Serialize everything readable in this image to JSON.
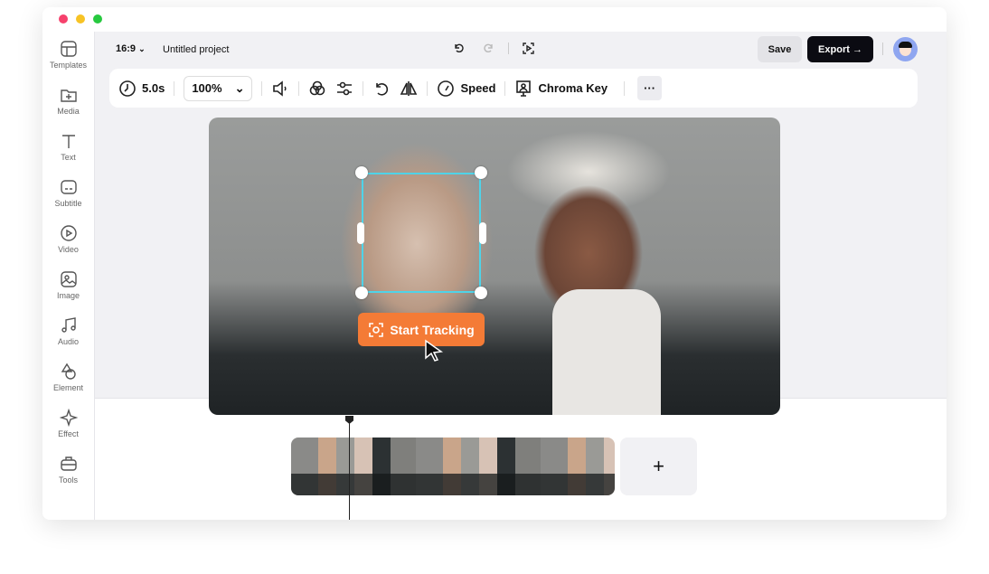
{
  "window": {
    "controls": [
      "close",
      "minimize",
      "maximize"
    ]
  },
  "sidebar": {
    "items": [
      {
        "label": "Templates",
        "icon": "templates-icon"
      },
      {
        "label": "Media",
        "icon": "folder-plus-icon"
      },
      {
        "label": "Text",
        "icon": "text-icon"
      },
      {
        "label": "Subtitle",
        "icon": "subtitle-icon"
      },
      {
        "label": "Video",
        "icon": "video-icon"
      },
      {
        "label": "Image",
        "icon": "image-icon"
      },
      {
        "label": "Audio",
        "icon": "music-icon"
      },
      {
        "label": "Element",
        "icon": "shapes-icon"
      },
      {
        "label": "Effect",
        "icon": "sparkle-icon"
      },
      {
        "label": "Tools",
        "icon": "toolbox-icon"
      }
    ]
  },
  "header": {
    "aspect_ratio": "16:9",
    "project_title": "Untitled project",
    "save_label": "Save",
    "export_label": "Export →"
  },
  "toolbar": {
    "duration": "5.0s",
    "zoom": "100%",
    "speed_label": "Speed",
    "chroma_key_label": "Chroma Key",
    "more_label": "···"
  },
  "canvas": {
    "tracking_button": "Start Tracking"
  },
  "timeline": {
    "add_label": "+"
  },
  "colors": {
    "accent": "#f47b36",
    "selection": "#4fd3e8",
    "export_bg": "#0b0b12"
  }
}
